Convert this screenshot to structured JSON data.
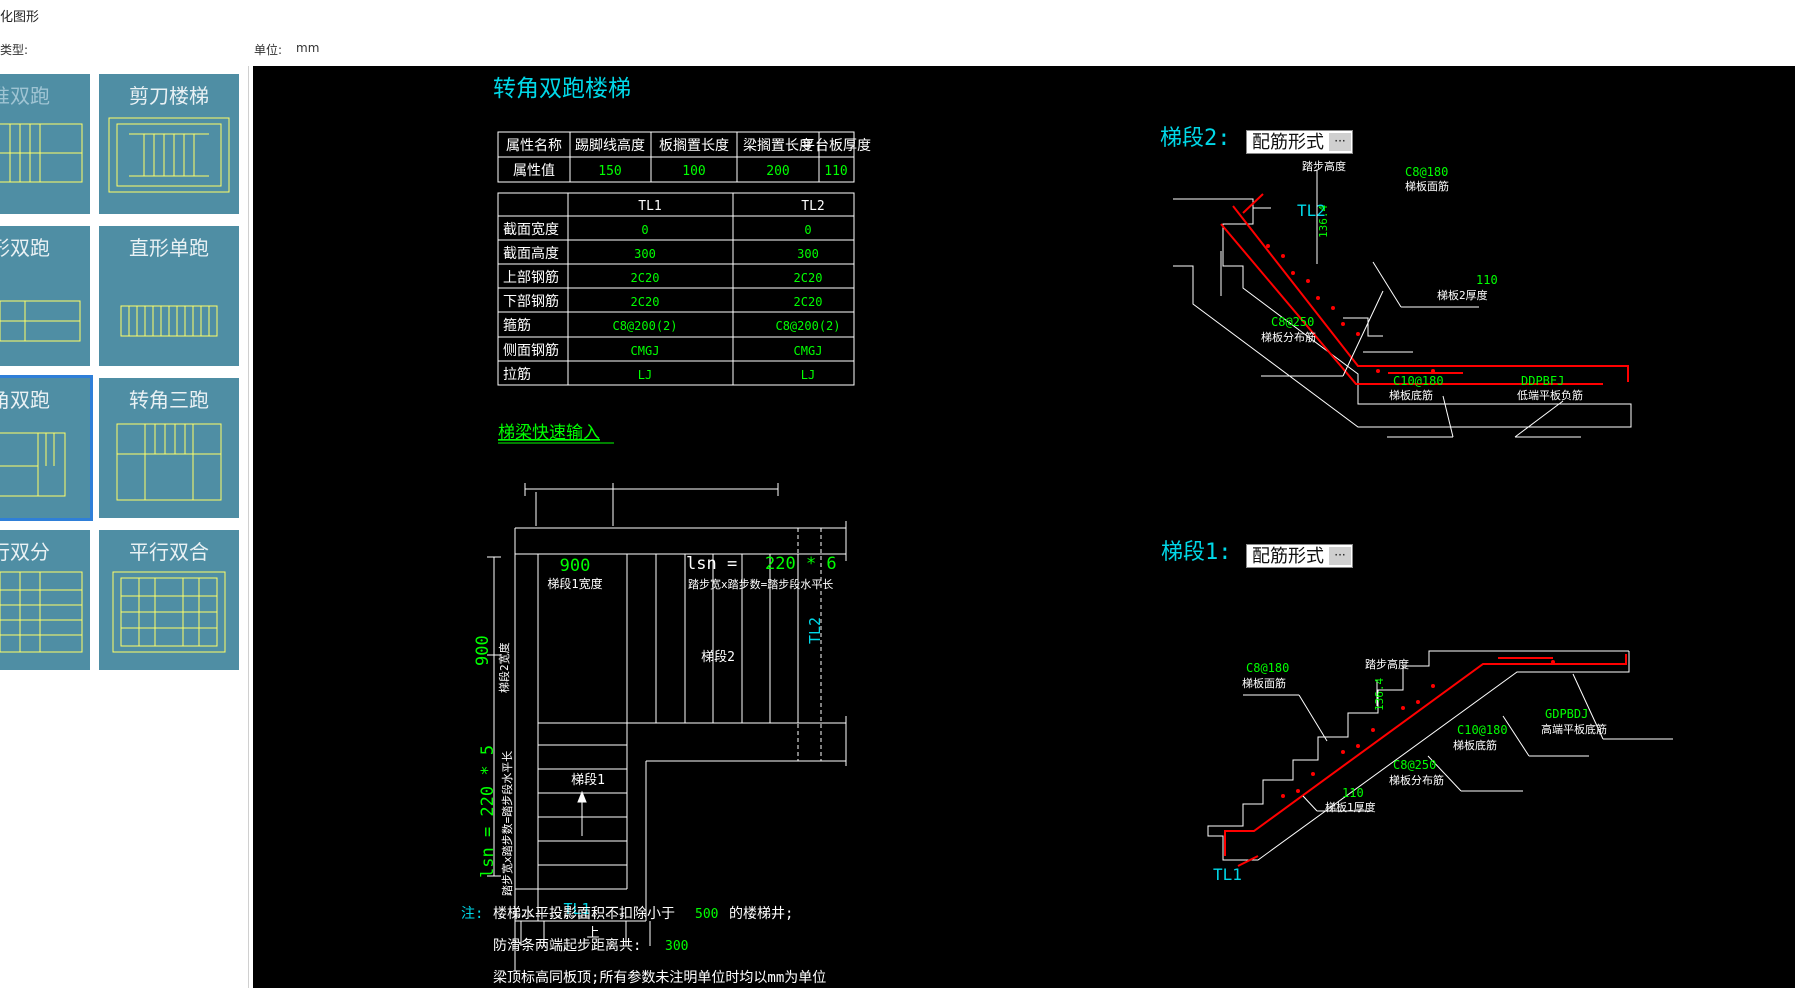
{
  "window": {
    "title": "化图形",
    "type_label": "类型:",
    "unit_label": "单位:",
    "unit_value": "mm"
  },
  "stair_types": [
    {
      "label": "准双跑"
    },
    {
      "label": "剪刀楼梯"
    },
    {
      "label": "形双跑"
    },
    {
      "label": "直形单跑"
    },
    {
      "label": "角双跑"
    },
    {
      "label": "转角三跑"
    },
    {
      "label": "行双分"
    },
    {
      "label": "平行双合"
    }
  ],
  "drawing": {
    "title": "转角双跑楼梯",
    "attr_table": {
      "header": [
        "属性名称",
        "踢脚线高度",
        "板搁置长度",
        "梁搁置长度",
        "平台板厚度"
      ],
      "row": [
        "属性值",
        "150",
        "100",
        "200",
        "110"
      ]
    },
    "beam_table": {
      "columns": [
        "",
        "TL1",
        "TL2"
      ],
      "rows": [
        [
          "截面宽度",
          "0",
          "0"
        ],
        [
          "截面高度",
          "300",
          "300"
        ],
        [
          "上部钢筋",
          "2C20",
          "2C20"
        ],
        [
          "下部钢筋",
          "2C20",
          "2C20"
        ],
        [
          "箍筋",
          "C8@200(2)",
          "C8@200(2)"
        ],
        [
          "侧面钢筋",
          "CMGJ",
          "CMGJ"
        ],
        [
          "拉筋",
          "LJ",
          "LJ"
        ]
      ]
    },
    "quick_input_link": "梯梁快速输入",
    "plan": {
      "dim_top_value": "900",
      "dim_top_label": "梯段1宽度",
      "lsn_prefix": "lsn = ",
      "lsn_value": "220 * 6",
      "lsn_label": "踏步宽x踏步数=踏步段水平长",
      "dim_left_value": "900",
      "dim_left_label": "梯段2宽度",
      "lsn_left": "lsn = 220 * 5",
      "lsn_left_label": "踏步宽x踏步数=踏步段水平长",
      "flight2": "梯段2",
      "flight1": "梯段1",
      "tl1": "TL1",
      "tl2": "TL2",
      "up": "上"
    },
    "notes": {
      "prefix": "注:",
      "line1_a": "楼梯水平投影面积不扣除小于",
      "line1_val": "500",
      "line1_b": "的楼梯井;",
      "line2_a": "防滑条两端起步距离共:",
      "line2_val": "300",
      "line3": "梁顶标高同板顶;所有参数未注明单位时均以mm为单位"
    },
    "section2": {
      "title": "梯段2:",
      "button": "配筋形式",
      "button_dots": "···",
      "tl": "TL2",
      "step_height": "踏步高度",
      "step_val": "136.4",
      "top_bar": "C8@180",
      "top_bar_label": "梯板面筋",
      "thick_val": "110",
      "thick_label": "梯板2厚度",
      "dist_bar": "C8@250",
      "dist_bar_label": "梯板分布筋",
      "bottom_bar": "C10@180",
      "bottom_bar_label": "梯板底筋",
      "neg_bar": "DDPBFJ",
      "neg_bar_label": "低端平板负筋"
    },
    "section1": {
      "title": "梯段1:",
      "button": "配筋形式",
      "button_dots": "···",
      "tl": "TL1",
      "step_height": "踏步高度",
      "step_val": "136.4",
      "top_bar": "C8@180",
      "top_bar_label": "梯板面筋",
      "bottom_bar": "C10@180",
      "bottom_bar_label": "梯板底筋",
      "dist_bar": "C8@250",
      "dist_bar_label": "梯板分布筋",
      "thick_val": "110",
      "thick_label": "梯板1厚度",
      "high_bar": "GDPBDJ",
      "high_bar_label": "高端平板底筋"
    }
  },
  "colors": {
    "canvas": "#000000",
    "line": "#ffffff",
    "value": "#00ff00",
    "cyan": "#00d8e8",
    "rebar": "#ff0000",
    "thumb_bg": "#4f8ea4",
    "thumb_line": "#ffff66"
  }
}
